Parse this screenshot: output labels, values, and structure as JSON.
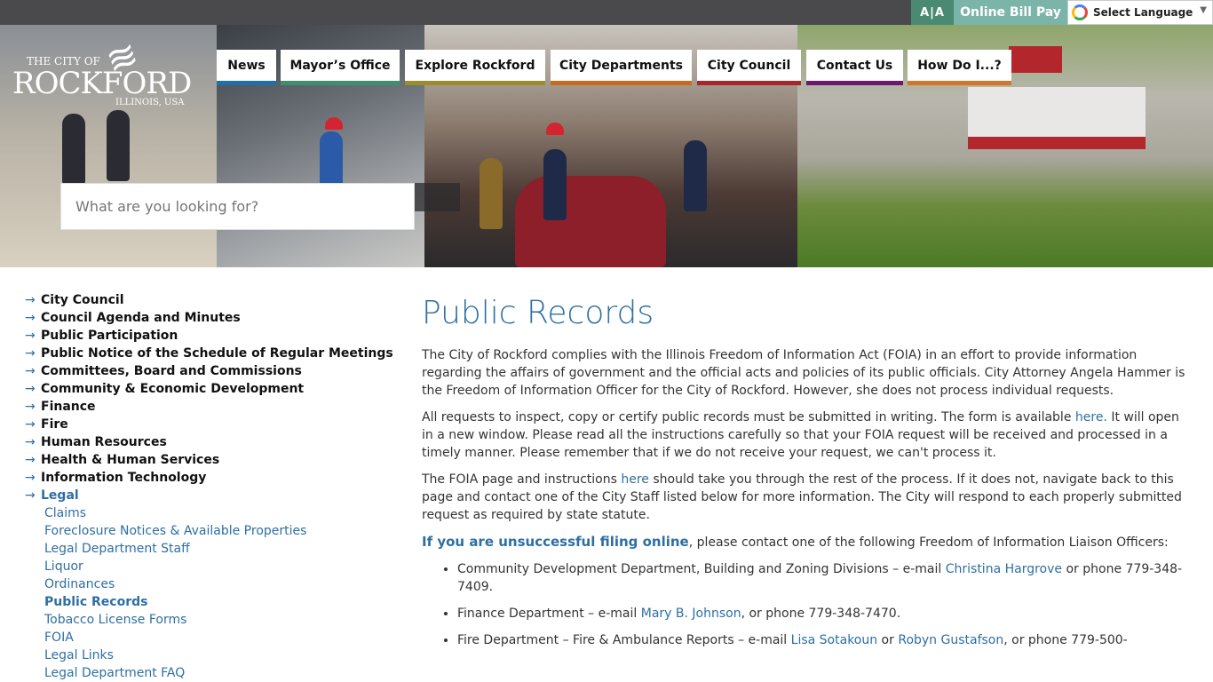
{
  "topbar": {
    "text_size_label": "A|A",
    "bill_pay_label": "Online Bill Pay",
    "language_label": "Select Language"
  },
  "logo": {
    "line1": "THE CITY OF",
    "line2": "ROCKFORD",
    "line3": "ILLINOIS, USA"
  },
  "nav": [
    {
      "label": "News",
      "color": "#1f6fa8"
    },
    {
      "label": "Mayor’s Office",
      "color": "#3f8f6c"
    },
    {
      "label": "Explore Rockford",
      "color": "#9b8c2e"
    },
    {
      "label": "City Departments",
      "color": "#c96a1c"
    },
    {
      "label": "City Council",
      "color": "#a3272d"
    },
    {
      "label": "Contact Us",
      "color": "#6b1a6b"
    },
    {
      "label": "How Do I...?",
      "color": "#d4762a"
    }
  ],
  "search": {
    "placeholder": "What are you looking for?"
  },
  "sidebar": {
    "items": [
      "City Council",
      "Council Agenda and Minutes",
      "Public Participation",
      "Public Notice of the Schedule of Regular Meetings",
      "Committees, Board and Commissions",
      "Community & Economic Development",
      "Finance",
      "Fire",
      "Human Resources",
      "Health & Human Services",
      "Information Technology",
      "Legal"
    ],
    "sub_items": [
      "Claims",
      "Foreclosure Notices & Available Properties",
      "Legal Department Staff",
      "Liquor",
      "Ordinances",
      "Public Records",
      "Tobacco License Forms",
      "FOIA",
      "Legal Links",
      "Legal Department FAQ"
    ]
  },
  "content": {
    "title": "Public Records",
    "p1": "The City of Rockford complies with the Illinois Freedom of Information Act (FOIA) in an effort to provide information regarding the affairs of government and the official acts and policies of its public officials.  City Attorney Angela Hammer is the Freedom of Information Officer for the City of Rockford.  However, she does not process individual requests.",
    "p2_a": "All requests to inspect, copy or certify public records must be submitted in writing.  The form is available ",
    "p2_link": "here.",
    "p2_b": " It will open in a new window.  Please read all the instructions carefully so that your FOIA request will be received and processed in a timely manner.  Please remember that if we do not receive your request, we can't process it.",
    "p3_a": "The FOIA page and instructions ",
    "p3_link": "here",
    "p3_b": " should take you through the rest of the process.  If it does not, navigate back to this page and contact one of the City Staff listed below for more information.  The City will respond to each properly submitted request as required by state statute.",
    "p4_link": "If you are unsuccessful filing online",
    "p4_b": ", please contact one of the following Freedom of Information Liaison Officers:",
    "officers": [
      {
        "pre": "Community Development Department, Building and Zoning Divisions – e-mail ",
        "link1": "Christina Hargrove",
        "mid": " or phone 779-348-7409.",
        "link2": "",
        "post": ""
      },
      {
        "pre": "Finance Department – e-mail ",
        "link1": "Mary B. Johnson",
        "mid": ", or phone 779-348-7470.",
        "link2": "",
        "post": ""
      },
      {
        "pre": "Fire Department – Fire & Ambulance Reports – e-mail ",
        "link1": "Lisa Sotakoun",
        "mid": " or ",
        "link2": "Robyn Gustafson",
        "post": ", or phone 779-500-"
      }
    ]
  }
}
